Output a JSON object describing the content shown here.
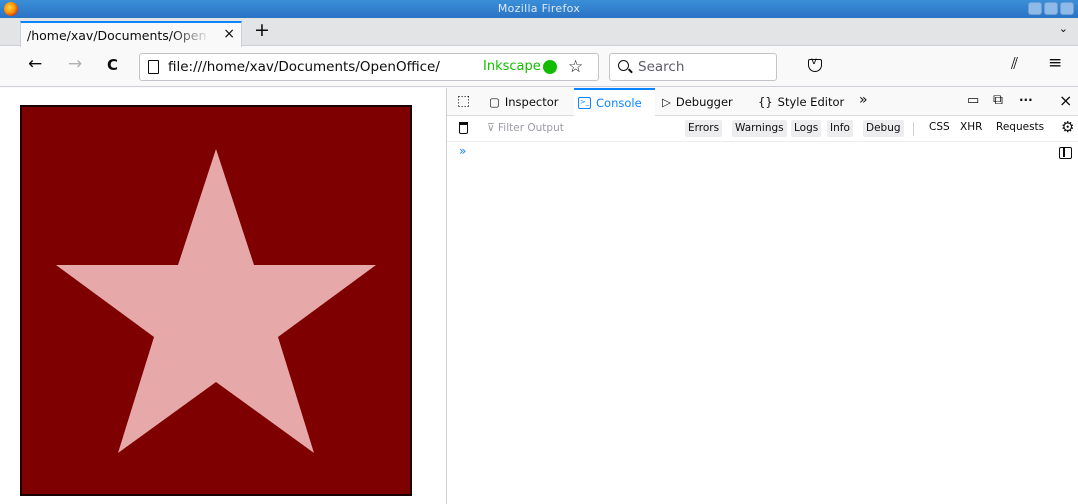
{
  "window": {
    "title": "Mozilla Firefox"
  },
  "tabs": [
    {
      "label": "/home/xav/Documents/OpenOffice/Inkscape",
      "close": "×"
    }
  ],
  "tabbar": {
    "new_tab": "+",
    "list_tabs": "⌄"
  },
  "nav": {
    "back": "←",
    "forward": "→",
    "reload": "C",
    "url": "file:///home/xav/Documents/OpenOffice/",
    "url_highlight": "Inkscape",
    "bookmark": "☆",
    "search_placeholder": "Search",
    "library": "⫽",
    "menu": "≡"
  },
  "page": {
    "canvas_color": "#7f0000",
    "star_color": "#e6a8a8"
  },
  "devtools": {
    "tabs": [
      "Inspector",
      "Console",
      "Debugger",
      "Style Editor"
    ],
    "active_tab": "Console",
    "more_tabs": "»",
    "filter_placeholder": "Filter Output",
    "filter_buttons": [
      "Errors",
      "Warnings",
      "Logs",
      "Info",
      "Debug"
    ],
    "filter_toggles": [
      "CSS",
      "XHR",
      "Requests"
    ],
    "prompt": "»",
    "toolbar_more": "···",
    "close": "×"
  },
  "colors": {
    "accent": "#0a84ff",
    "secure_green": "#12bc00"
  }
}
